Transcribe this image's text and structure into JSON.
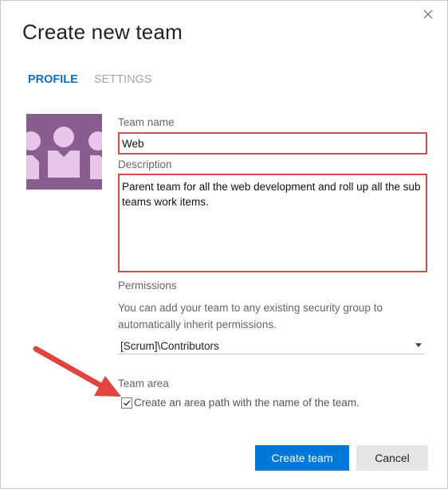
{
  "dialog": {
    "title": "Create new team",
    "close_icon": "close-icon"
  },
  "tabs": [
    {
      "label": "PROFILE",
      "active": true
    },
    {
      "label": "SETTINGS",
      "active": false
    }
  ],
  "avatar": {
    "icon": "team-avatar-icon",
    "color": "#8a5d91"
  },
  "fields": {
    "team_name_label": "Team name",
    "team_name_value": "Web",
    "description_label": "Description",
    "description_value": "Parent team for all the web development and roll up all the sub teams work items."
  },
  "permissions": {
    "label": "Permissions",
    "help_text": "You can add your team to any existing security group to automatically inherit permissions.",
    "selected_group": "[Scrum]\\Contributors"
  },
  "team_area": {
    "label": "Team area",
    "checkbox_label": "Create an area path with the name of the team.",
    "checked": true
  },
  "buttons": {
    "create_label": "Create team",
    "cancel_label": "Cancel"
  },
  "colors": {
    "accent": "#0078d7",
    "tab_active": "#106ebe",
    "highlight_border": "#d74a4a",
    "annotation_arrow": "#e0443b"
  }
}
